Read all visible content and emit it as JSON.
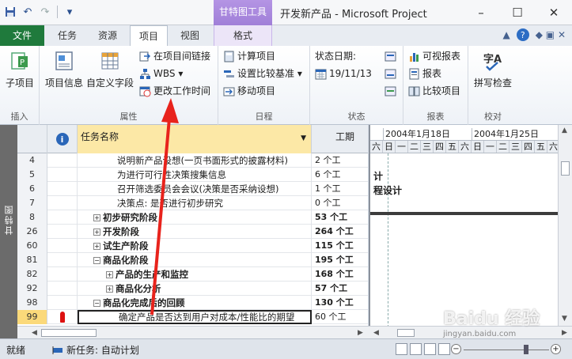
{
  "window": {
    "context_tab_group": "甘特图工具",
    "title": "开发新产品 - Microsoft Project",
    "min": "–",
    "max": "☐",
    "close": "✕"
  },
  "qat": {
    "save_icon": "save-icon",
    "undo": "↶",
    "redo": "↷",
    "customize": "▾"
  },
  "tabs": {
    "file": "文件",
    "items": [
      "任务",
      "资源",
      "项目",
      "视图",
      "格式"
    ],
    "active": "项目",
    "collapse": "▲",
    "help": "?",
    "extra": "◆ ▣ ✕"
  },
  "ribbon": {
    "groups": {
      "insert": {
        "label": "插入",
        "subproject": "子项目"
      },
      "properties": {
        "label": "属性",
        "project_info": "项目信息",
        "custom_fields": "自定义字段",
        "links_between_projects": "在项目间链接",
        "wbs": "WBS ▾",
        "change_working_time": "更改工作时间"
      },
      "schedule": {
        "label": "日程",
        "calculate_project": "计算项目",
        "set_baseline": "设置比较基准 ▾",
        "move_project": "移动项目"
      },
      "status": {
        "label": "状态",
        "status_date_label": "状态日期:",
        "status_date": "19/11/13"
      },
      "reports": {
        "label": "报表",
        "visual_reports": "可视报表",
        "reports": "报表",
        "compare_projects": "比较项目"
      },
      "proofing": {
        "label": "校对",
        "spelling": "拼写检查"
      }
    }
  },
  "sidebar": {
    "view_label": "甘特图"
  },
  "table": {
    "header_name": "任务名称",
    "header_duration": "工期",
    "rows": [
      {
        "id": "4",
        "name": "说明新产品设想(一页书面形式的披露材料)",
        "duration": "2 个工",
        "indent": 2,
        "summary": false
      },
      {
        "id": "5",
        "name": "为进行可行性决策搜集信息",
        "duration": "6 个工",
        "indent": 2,
        "summary": false
      },
      {
        "id": "6",
        "name": "召开筛选委员会会议(决策是否采纳设想)",
        "duration": "1 个工",
        "indent": 2,
        "summary": false
      },
      {
        "id": "7",
        "name": "决策点: 是否进行初步研究",
        "duration": "0 个工",
        "indent": 2,
        "summary": false
      },
      {
        "id": "8",
        "name": "初步研究阶段",
        "duration": "53 个工",
        "indent": 1,
        "summary": true,
        "toggle": "+"
      },
      {
        "id": "26",
        "name": "开发阶段",
        "duration": "264 个工",
        "indent": 1,
        "summary": true,
        "toggle": "+"
      },
      {
        "id": "60",
        "name": "试生产阶段",
        "duration": "115 个工",
        "indent": 1,
        "summary": true,
        "toggle": "+"
      },
      {
        "id": "81",
        "name": "商品化阶段",
        "duration": "195 个工",
        "indent": 1,
        "summary": true,
        "toggle": "−"
      },
      {
        "id": "82",
        "name": "产品的生产和监控",
        "duration": "168 个工",
        "indent": 2,
        "summary": true,
        "toggle": "+"
      },
      {
        "id": "92",
        "name": "商品化分析",
        "duration": "57 个工",
        "indent": 2,
        "summary": true,
        "toggle": "+"
      },
      {
        "id": "98",
        "name": "商品化完成后的回顾",
        "duration": "130 个工",
        "indent": 1,
        "summary": true,
        "toggle": "−"
      },
      {
        "id": "99",
        "name": "确定产品是否达到用户对成本/性能比的期望",
        "duration": "60 个工",
        "indent": 2,
        "summary": false,
        "selected": true
      }
    ]
  },
  "gantt": {
    "week1": "2004年1月18日",
    "week2": "2004年1月25日",
    "days": [
      "六",
      "日",
      "一",
      "二",
      "三",
      "四",
      "五",
      "六",
      "日",
      "一",
      "二",
      "三",
      "四",
      "五",
      "六"
    ],
    "row5_text": "计",
    "row6_text": "程设计"
  },
  "status_bar": {
    "ready": "就绪",
    "new_task": "新任务: 自动计划",
    "zoom_minus": "−",
    "zoom_plus": "+"
  },
  "watermark": {
    "brand": "Baidu 经验",
    "url": "jingyan.baidu.com"
  }
}
